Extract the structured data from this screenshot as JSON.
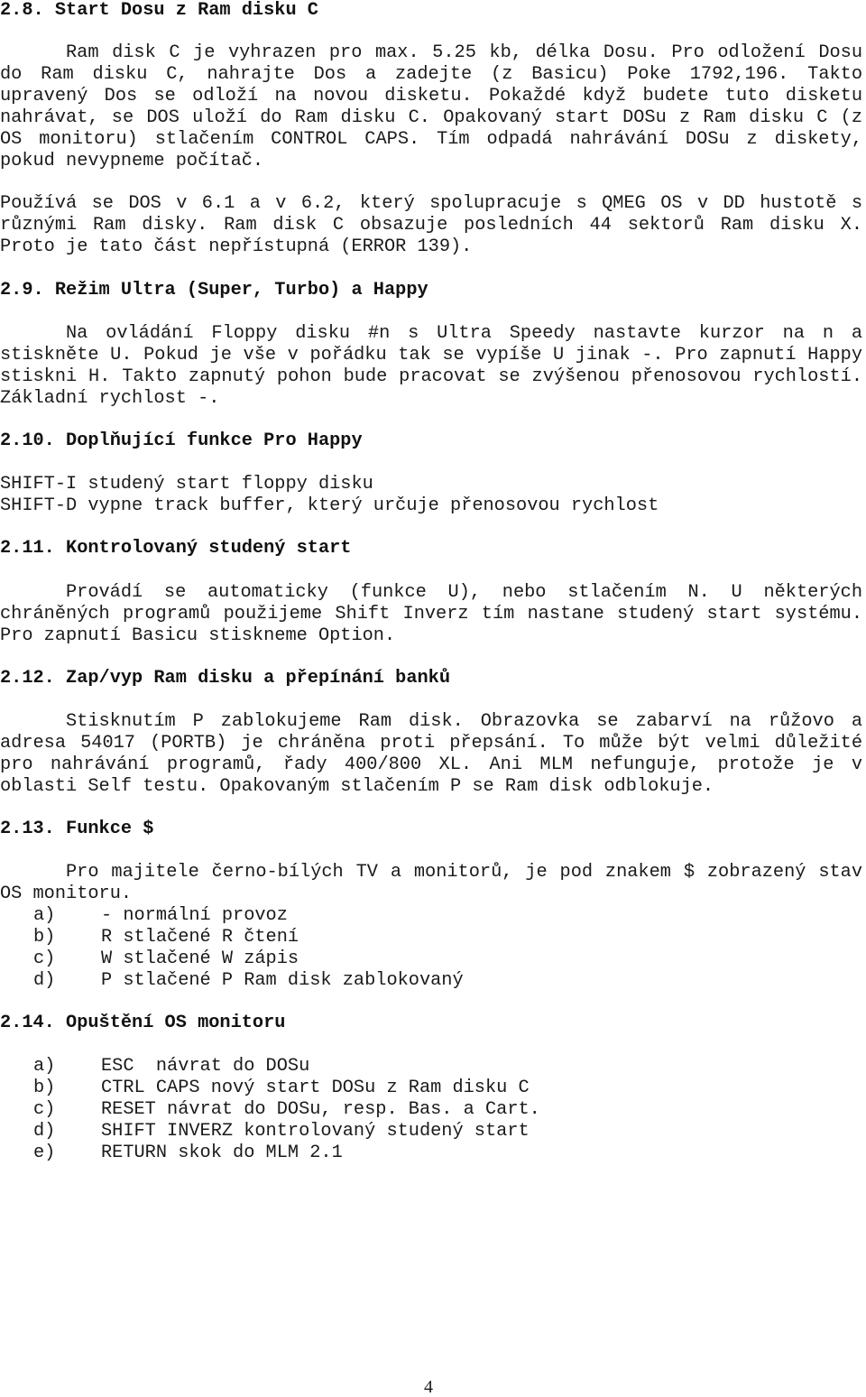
{
  "sections": {
    "s2_8": {
      "heading": "2.8. Start Dosu z Ram disku C",
      "para1": "Ram disk C je vyhrazen pro max. 5.25 kb, délka Dosu. Pro odložení Dosu do Ram disku C, nahrajte Dos a zadejte (z Basicu) Poke 1792,196. Takto upravený Dos se odloží na novou disketu. Pokaždé když budete tuto disketu nahrávat, se DOS uloží do Ram disku C. Opakovaný start DOSu z Ram disku C (z OS monitoru) stlačením CONTROL CAPS. Tím odpadá nahrávání DOSu z diskety, pokud nevypneme počítač.",
      "para2": "Používá se DOS v 6.1 a v 6.2, který spolupracuje s QMEG OS v DD hustotě s různými Ram disky. Ram disk C obsazuje posledních 44 sektorů Ram disku X. Proto je tato část nepřístupná (ERROR 139)."
    },
    "s2_9": {
      "heading": "2.9. Režim Ultra (Super, Turbo) a Happy",
      "para1": "Na ovládání Floppy disku #n s Ultra Speedy nastavte kurzor na n a stiskněte U. Pokud je vše v pořádku tak se vypíše U jinak -. Pro zapnutí Happy stiskni H. Takto zapnutý pohon bude pracovat se zvýšenou přenosovou rychlostí. Základní rychlost -."
    },
    "s2_10": {
      "heading": "2.10. Doplňující funkce Pro Happy",
      "lines": [
        "SHIFT-I studený start floppy disku",
        "SHIFT-D vypne track buffer, který určuje přenosovou rychlost"
      ]
    },
    "s2_11": {
      "heading": "2.11. Kontrolovaný studený start",
      "para1": "Provádí se automaticky (funkce U), nebo stlačením N. U některých chráněných programů použijeme Shift Inverz tím nastane studený start systému. Pro zapnutí Basicu stiskneme Option."
    },
    "s2_12": {
      "heading": "2.12. Zap/vyp Ram disku a přepínání banků",
      "para1": "Stisknutím P zablokujeme Ram disk. Obrazovka se zabarví na růžovo a adresa 54017 (PORTB) je chráněna proti přepsání. To může být velmi důležité pro nahrávání programů, řady 400/800 XL. Ani MLM nefunguje, protože je v oblasti Self testu. Opakovaným stlačením P se Ram disk odblokuje."
    },
    "s2_13": {
      "heading": "2.13. Funkce $",
      "para1": "Pro majitele černo-bílých TV a monitorů, je pod znakem $ zobrazený stav OS monitoru.",
      "items": [
        {
          "marker": "a)",
          "text": "- normální provoz"
        },
        {
          "marker": "b)",
          "text": "R stlačené R čtení"
        },
        {
          "marker": "c)",
          "text": "W stlačené W zápis"
        },
        {
          "marker": "d)",
          "text": "P stlačené P Ram disk zablokovaný"
        }
      ]
    },
    "s2_14": {
      "heading": "2.14. Opuštění OS monitoru",
      "items": [
        {
          "marker": "a)",
          "text": "ESC  návrat do DOSu"
        },
        {
          "marker": "b)",
          "text": "CTRL CAPS nový start DOSu z Ram disku C"
        },
        {
          "marker": "c)",
          "text": "RESET návrat do DOSu, resp. Bas. a Cart."
        },
        {
          "marker": "d)",
          "text": "SHIFT INVERZ kontrolovaný studený start"
        },
        {
          "marker": "e)",
          "text": "RETURN skok do MLM 2.1"
        }
      ]
    }
  },
  "page_number": "4"
}
